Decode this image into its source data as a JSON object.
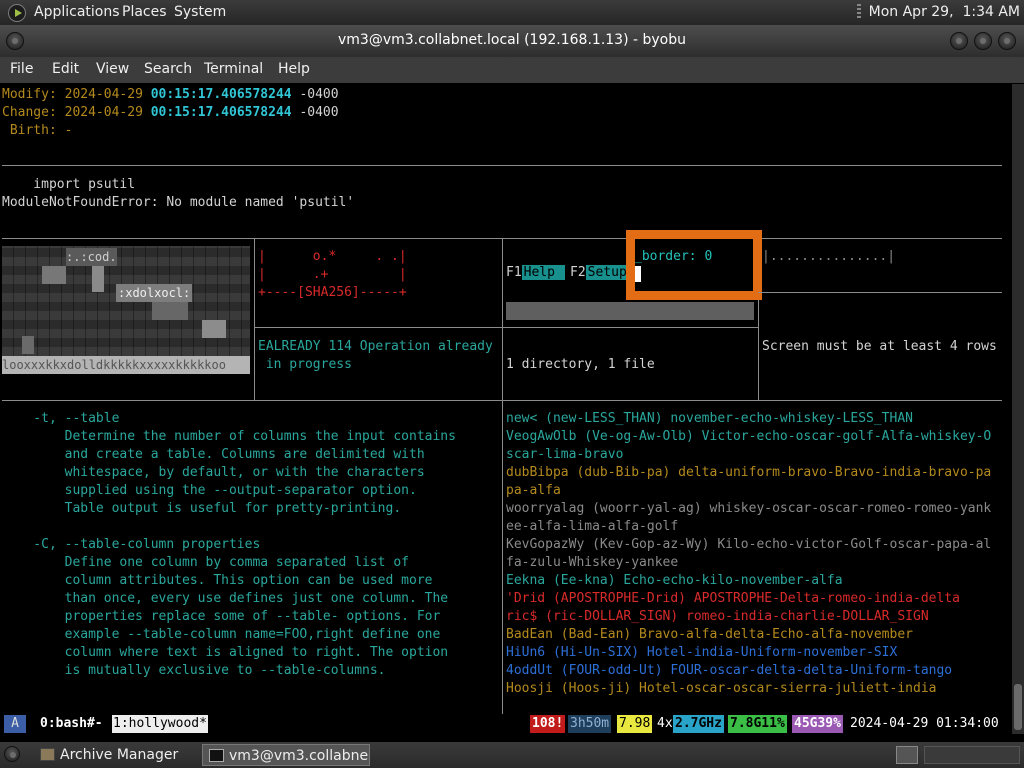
{
  "panel": {
    "applications": "Applications",
    "places": "Places",
    "system": "System",
    "clock": "Mon Apr 29,  1:34 AM"
  },
  "window": {
    "title": "vm3@vm3.collabnet.local (192.168.1.13) - byobu"
  },
  "menubar": {
    "file": "File",
    "edit": "Edit",
    "view": "View",
    "search": "Search",
    "terminal": "Terminal",
    "help": "Help"
  },
  "terminal": {
    "stat": {
      "modify_label": "Modify:",
      "modify_date": "2024-04-29",
      "modify_time": "00:15:17.406578244",
      "modify_tz": "-0400",
      "change_label": "Change:",
      "change_date": "2024-04-29",
      "change_time": "00:15:17.406578244",
      "change_tz": "-0400",
      "birth": " Birth: -"
    },
    "python": {
      "import": "    import psutil",
      "error": "ModuleNotFoundError: No module named 'psutil'"
    },
    "hollywood": {
      "pix_label1": ":.:cod.",
      "pix_label2": ":xdolxocl:",
      "pix_label3": "looxxxkkxdolldkkkkkxxxxxkkkkkoo",
      "sha_line1": "|      o.*     . .|",
      "sha_line2": "|      .+         |",
      "sha_line3": "+----[SHA256]-----+",
      "f1": "F1",
      "f1_label": "Help ",
      "f2": "F2",
      "f2_label": "Setup",
      "border_text": "_border: 0",
      "dots": "|...............|",
      "ealready": "EALREADY 114 Operation already\n in progress",
      "dirfile": "1 directory, 1 file",
      "screen_msg": "Screen must be at least 4 rows"
    },
    "manpage": [
      "    -t, --table",
      "        Determine the number of columns the input contains",
      "        and create a table. Columns are delimited with",
      "        whitespace, by default, or with the characters",
      "        supplied using the --output-separator option.",
      "        Table output is useful for pretty-printing.",
      "",
      "    -C, --table-column properties",
      "        Define one column by comma separated list of",
      "        column attributes. This option can be used more",
      "        than once, every use defines just one column. The",
      "        properties replace some of --table- options. For",
      "        example --table-column name=FOO,right define one",
      "        column where text is aligned to right. The option",
      "        is mutually exclusive to --table-columns."
    ],
    "words": [
      {
        "text": "new< (new-LESS_THAN) november-echo-whiskey-LESS_THAN",
        "color": "#2aa79d"
      },
      {
        "text": "VeogAwOlb (Ve-og-Aw-Olb) Victor-echo-oscar-golf-Alfa-whiskey-O",
        "color": "#2aa79d"
      },
      {
        "text": "scar-lima-bravo",
        "color": "#2aa79d"
      },
      {
        "text": "dubBibpa (dub-Bib-pa) delta-uniform-bravo-Bravo-india-bravo-pa",
        "color": "#b48a1e"
      },
      {
        "text": "pa-alfa",
        "color": "#b48a1e"
      },
      {
        "text": "woorryalag (woorr-yal-ag) whiskey-oscar-oscar-romeo-romeo-yank",
        "color": "#8a8a8a"
      },
      {
        "text": "ee-alfa-lima-alfa-golf",
        "color": "#8a8a8a"
      },
      {
        "text": "KevGopazWy (Kev-Gop-az-Wy) Kilo-echo-victor-Golf-oscar-papa-al",
        "color": "#8a8a8a"
      },
      {
        "text": "fa-zulu-Whiskey-yankee",
        "color": "#8a8a8a"
      },
      {
        "text": "Eekna (Ee-kna) Echo-echo-kilo-november-alfa",
        "color": "#2aa79d"
      },
      {
        "text": "'Drid (APOSTROPHE-Drid) APOSTROPHE-Delta-romeo-india-delta",
        "color": "#d92a2a"
      },
      {
        "text": "ric$ (ric-DOLLAR_SIGN) romeo-india-charlie-DOLLAR_SIGN",
        "color": "#d92a2a"
      },
      {
        "text": "BadEan (Bad-Ean) Bravo-alfa-delta-Echo-alfa-november",
        "color": "#b48a1e"
      },
      {
        "text": "HiUn6 (Hi-Un-SIX) Hotel-india-Uniform-november-SIX",
        "color": "#2c6fd6"
      },
      {
        "text": "4oddUt (FOUR-odd-Ut) FOUR-oscar-delta-delta-Uniform-tango",
        "color": "#2c6fd6"
      },
      {
        "text": "Hoosji (Hoos-ji) Hotel-oscar-oscar-sierra-juliett-india",
        "color": "#b48a1e"
      }
    ]
  },
  "status": {
    "a": "A",
    "win0": "0:bash#-",
    "win1": "1:hollywood*",
    "load": "108!",
    "uptime": "3h50m",
    "loadavg": "7.98",
    "cpu_count": "4x",
    "cpu_freq": "2.7GHz",
    "mem": "7.8G11%",
    "disk": "45G39%",
    "datetime": "2024-04-29 01:34:00"
  },
  "taskbar": {
    "archive": "Archive Manager",
    "terminal": "vm3@vm3.collabne..."
  }
}
